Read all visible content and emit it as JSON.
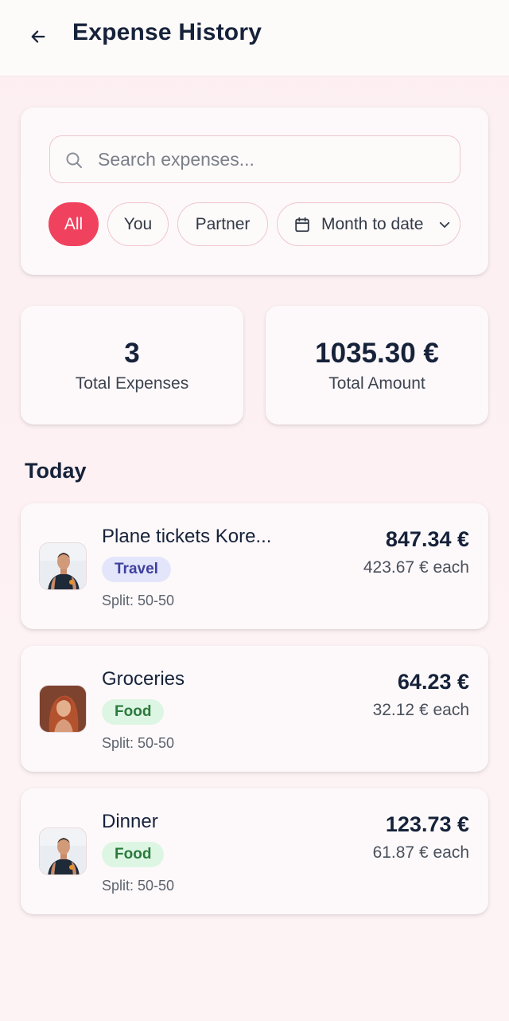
{
  "header": {
    "title": "Expense History",
    "back_icon": "arrow-left-icon"
  },
  "search": {
    "placeholder": "Search expenses...",
    "value": "",
    "icon": "search-icon"
  },
  "filters": {
    "chips": [
      {
        "label": "All",
        "active": true
      },
      {
        "label": "You",
        "active": false
      },
      {
        "label": "Partner",
        "active": false
      }
    ],
    "date_range": {
      "label": "Month to date",
      "icon": "calendar-icon",
      "dropdown_icon": "chevron-down-icon"
    }
  },
  "stats": {
    "total_expenses": {
      "value": "3",
      "label": "Total Expenses"
    },
    "total_amount": {
      "value": "1035.30 €",
      "label": "Total Amount"
    }
  },
  "section": {
    "title": "Today"
  },
  "expenses": [
    {
      "title": "Plane tickets Kore...",
      "category": "Travel",
      "split": "Split: 50-50",
      "amount": "847.34 €",
      "each": "423.67 € each",
      "avatar": "man-avatar"
    },
    {
      "title": "Groceries",
      "category": "Food",
      "split": "Split: 50-50",
      "amount": "64.23 €",
      "each": "32.12 € each",
      "avatar": "woman-avatar"
    },
    {
      "title": "Dinner",
      "category": "Food",
      "split": "Split: 50-50",
      "amount": "123.73 €",
      "each": "61.87 € each",
      "avatar": "man-avatar"
    }
  ],
  "colors": {
    "accent": "#f0425e",
    "travel_badge": "#e3e6fb",
    "food_badge": "#ddf6e3"
  }
}
